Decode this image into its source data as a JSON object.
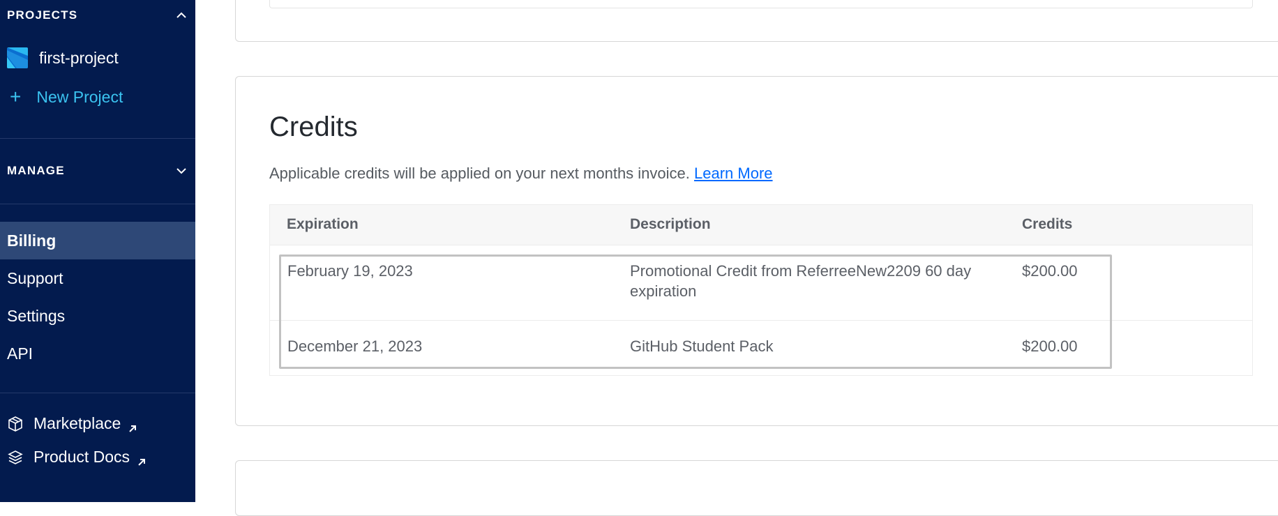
{
  "sidebar": {
    "projects_heading": "PROJECTS",
    "projects": [
      {
        "name": "first-project"
      }
    ],
    "new_project_label": "New Project",
    "manage_heading": "MANAGE",
    "nav": [
      {
        "label": "Billing",
        "active": true
      },
      {
        "label": "Support",
        "active": false
      },
      {
        "label": "Settings",
        "active": false
      },
      {
        "label": "API",
        "active": false
      }
    ],
    "external_links": [
      {
        "label": "Marketplace",
        "icon": "marketplace-icon"
      },
      {
        "label": "Product Docs",
        "icon": "product-docs-icon"
      }
    ]
  },
  "credits": {
    "title": "Credits",
    "description": "Applicable credits will be applied on your next months invoice.",
    "learn_more": "Learn More",
    "columns": [
      "Expiration",
      "Description",
      "Credits"
    ],
    "rows": [
      {
        "expiration": "February 19, 2023",
        "description": "Promotional Credit from ReferreeNew2209 60 day expiration",
        "credits": "$200.00"
      },
      {
        "expiration": "December 21, 2023",
        "description": "GitHub Student Pack",
        "credits": "$200.00"
      }
    ]
  },
  "colors": {
    "sidebar_bg": "#031b4e",
    "sidebar_active_bg": "#2e4877",
    "accent_link": "#0069ff",
    "new_project": "#3bc3f0"
  }
}
